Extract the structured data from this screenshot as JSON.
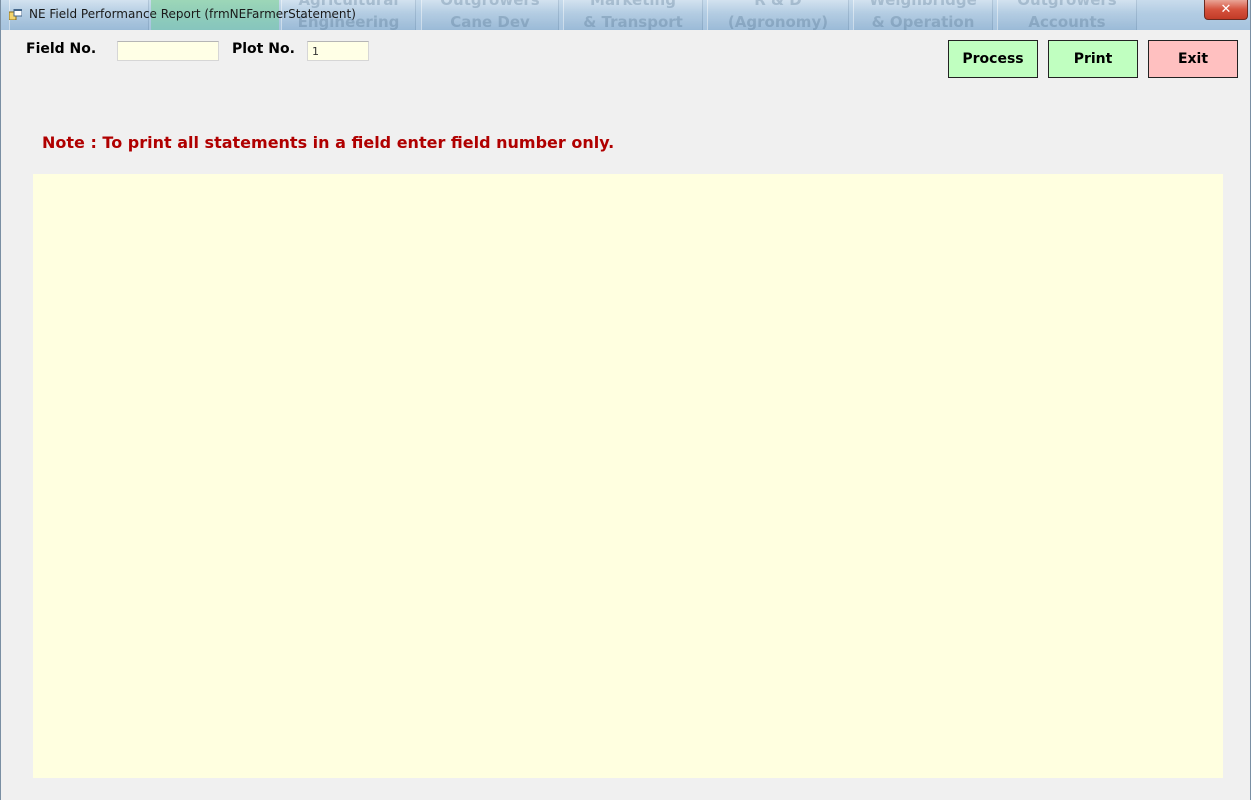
{
  "window": {
    "title": "NE Field Performance Report (frmNEFarmerStatement)",
    "close_label": "✕"
  },
  "background_tabs": [
    {
      "line1": "",
      "line2": ""
    },
    {
      "line1": "Agricultural",
      "line2": "Engineering"
    },
    {
      "line1": "Outgrowers",
      "line2": "Cane Dev"
    },
    {
      "line1": "Marketing",
      "line2": "& Transport"
    },
    {
      "line1": "R & D",
      "line2": "(Agronomy)"
    },
    {
      "line1": "Weighbridge",
      "line2": "& Operation"
    },
    {
      "line1": "Outgrowers",
      "line2": "Accounts"
    }
  ],
  "form": {
    "field_no_label": "Field No.",
    "field_no_value": "",
    "plot_no_label": "Plot No.",
    "plot_no_value": "1",
    "note": "Note : To print all statements in a field enter field number only."
  },
  "buttons": {
    "process": "Process",
    "print": "Print",
    "exit": "Exit"
  },
  "colors": {
    "input_bg": "#ffffe6",
    "button_green": "#c0ffc0",
    "button_red": "#ffc0c0",
    "note_red": "#b00000",
    "report_panel_bg": "#ffffe0"
  }
}
